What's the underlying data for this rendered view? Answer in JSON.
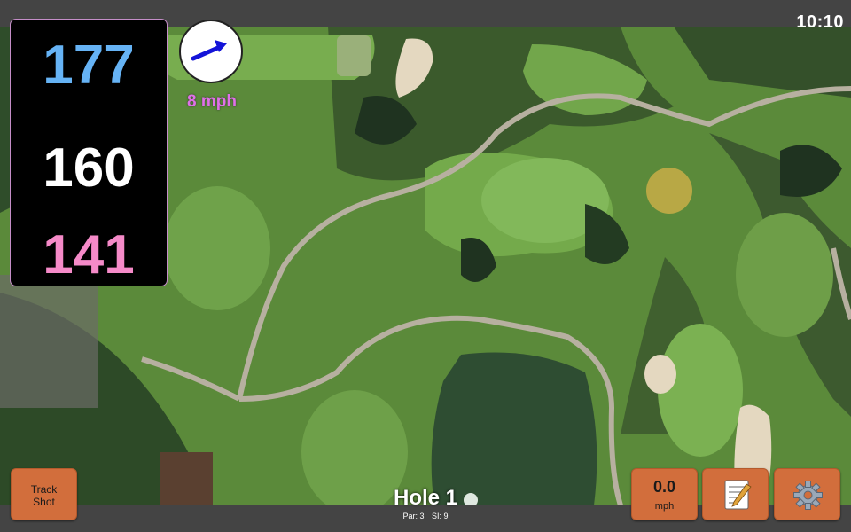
{
  "status": {
    "time": "10:10"
  },
  "distances": {
    "back": "177",
    "middle": "160",
    "front": "141",
    "colors": {
      "back": "#66b3f5",
      "middle": "#ffffff",
      "front": "#f58ac8"
    }
  },
  "wind": {
    "speed_label": "8 mph",
    "direction_icon": "arrow-icon",
    "color": "#e070e8",
    "arrow_color": "#1414d8"
  },
  "buttons": {
    "track_shot": [
      "Track",
      "Shot"
    ],
    "speed_value": "0.0",
    "speed_unit": "mph",
    "notes_icon": "memo-icon",
    "settings_icon": "gear-icon"
  },
  "hole": {
    "title": "Hole 1",
    "par": "Par: 3",
    "si": "SI: 9"
  },
  "map": {
    "type": "aerial golf course",
    "accent": "#d26e3c"
  }
}
